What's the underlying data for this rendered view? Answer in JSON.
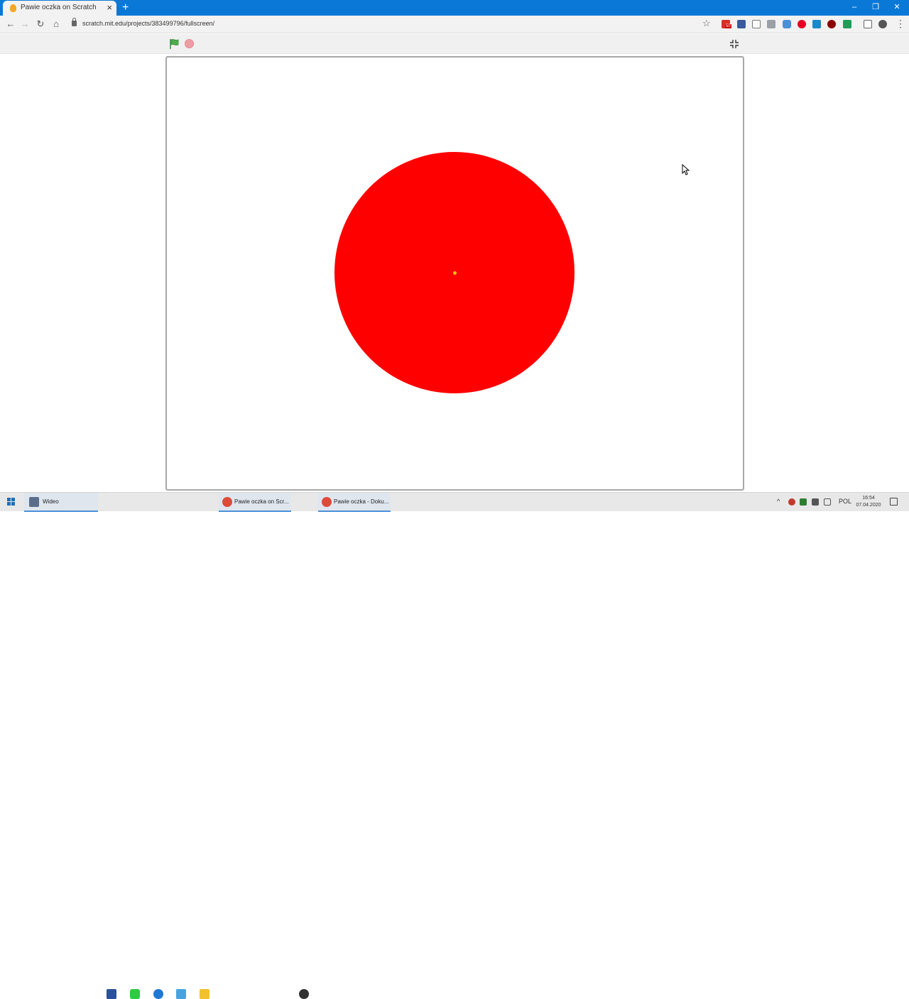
{
  "browser": {
    "tab_title": "Pawie oczka on Scratch",
    "tab_close": "×",
    "new_tab": "+",
    "url": "scratch.mit.edu/projects/383499796/fullscreen/",
    "nav": {
      "back": "←",
      "forward": "→",
      "reload": "↻",
      "home": "⌂"
    },
    "window_controls": {
      "minimize": "–",
      "restore": "❐",
      "close": "✕"
    },
    "bookmark_icon": "star-icon",
    "extension_badge": "50",
    "menu": "⋮"
  },
  "scratch": {
    "green_flag": "green-flag-icon",
    "stop": "stop-icon",
    "exit_fullscreen": "exit-fullscreen-icon",
    "stage": {
      "sprite": "red-circle",
      "sprite_color": "#ff0000"
    }
  },
  "taskbar": {
    "items": [
      {
        "label": "Wideo",
        "active": true
      },
      {
        "label": ""
      },
      {
        "label": ""
      },
      {
        "label": ""
      },
      {
        "label": ""
      },
      {
        "label": ""
      },
      {
        "label": "Pawie oczka on Scr...",
        "active": true
      },
      {
        "label": ""
      },
      {
        "label": "Pawie oczka - Doku...",
        "active": true
      }
    ],
    "tray": {
      "chevron": "^",
      "language": "POL"
    },
    "clock": {
      "time": "16:54",
      "date": "07.04.2020"
    }
  },
  "colors": {
    "chrome_blue": "#0a78d7",
    "sprite_red": "#ff0000",
    "flag_green": "#4cae4c",
    "stop_pink": "#ec9ea5"
  }
}
